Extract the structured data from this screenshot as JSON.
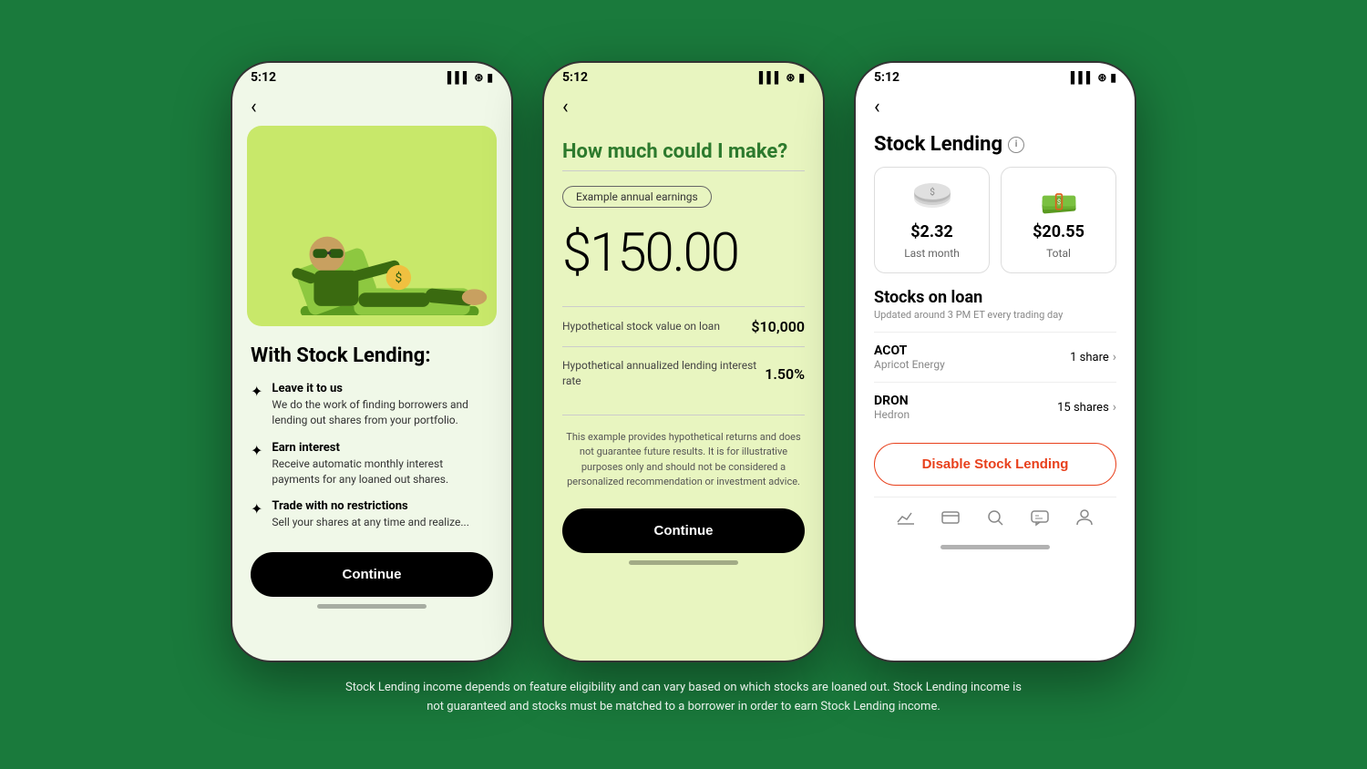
{
  "background_color": "#1a7a3c",
  "footer_text": "Stock Lending income depends on feature eligibility and can vary based on which stocks are loaned out. Stock Lending income is not guaranteed and stocks must be matched to a borrower in order to earn Stock Lending income.",
  "phone1": {
    "status_time": "5:12",
    "back_label": "‹",
    "title": "With Stock Lending:",
    "features": [
      {
        "title": "Leave it to us",
        "desc": "We do the work of finding borrowers and lending out shares from your portfolio."
      },
      {
        "title": "Earn interest",
        "desc": "Receive automatic monthly interest payments for any loaned out shares."
      },
      {
        "title": "Trade with no restrictions",
        "desc": "Sell your shares at any time and realize..."
      }
    ],
    "continue_label": "Continue"
  },
  "phone2": {
    "status_time": "5:12",
    "back_label": "‹",
    "title": "How much could I make?",
    "earnings_badge": "Example annual earnings",
    "earnings_amount": "$150.00",
    "calc_rows": [
      {
        "label": "Hypothetical stock\nvalue on loan",
        "value": "$10,000"
      },
      {
        "label": "Hypothetical annualized\nlending interest rate",
        "value": "1.50%"
      }
    ],
    "disclaimer": "This example provides hypothetical returns and does not guarantee future results. It is for illustrative purposes only and should not be considered a personalized recommendation or investment advice.",
    "continue_label": "Continue"
  },
  "phone3": {
    "status_time": "5:12",
    "back_label": "‹",
    "title": "Stock Lending",
    "info_icon": "i",
    "last_month_amount": "$2.32",
    "last_month_label": "Last month",
    "total_amount": "$20.55",
    "total_label": "Total",
    "stocks_title": "Stocks on loan",
    "stocks_subtitle": "Updated around 3 PM ET every trading day",
    "stocks": [
      {
        "ticker": "ACOT",
        "name": "Apricot Energy",
        "shares": "1 share"
      },
      {
        "ticker": "DRON",
        "name": "Hedron",
        "shares": "15 shares"
      }
    ],
    "disable_label": "Disable Stock Lending",
    "nav_icons": [
      "chart",
      "card",
      "search",
      "chat",
      "person"
    ]
  }
}
